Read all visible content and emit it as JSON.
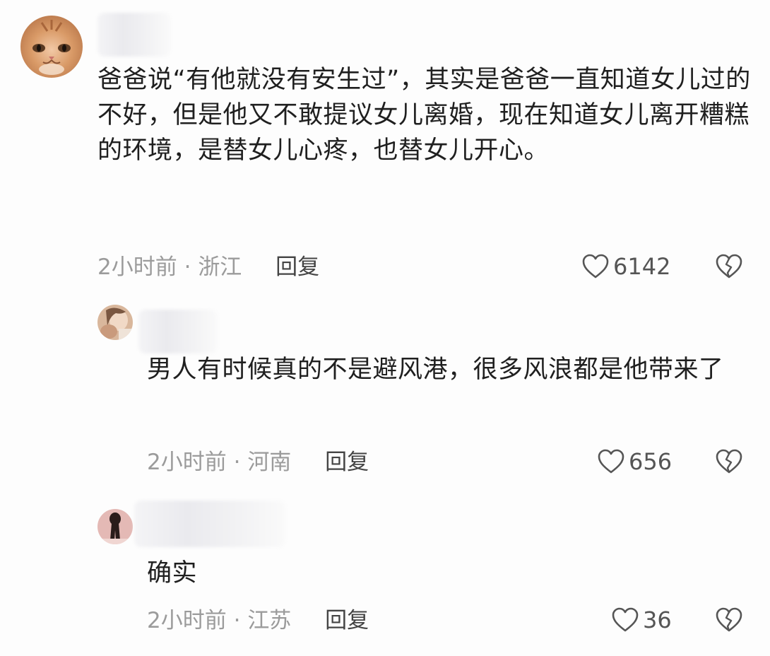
{
  "comments": [
    {
      "text": "爸爸说“有他就没有安生过”，其实是爸爸一直知道女儿过的不好，但是他又不敢提议女儿离婚，现在知道女儿离开糟糕的环境，是替女儿心疼，也替女儿开心。",
      "time": "2小时前",
      "location": "浙江",
      "reply_label": "回复",
      "likes": "6142"
    },
    {
      "text": "男人有时候真的不是避风港，很多风浪都是他带来了",
      "time": "2小时前",
      "location": "河南",
      "reply_label": "回复",
      "likes": "656"
    },
    {
      "text": "确实",
      "time": "2小时前",
      "location": "江苏",
      "reply_label": "回复",
      "likes": "36"
    }
  ],
  "meta_separator": "·",
  "colors": {
    "text": "#1f1f1f",
    "meta": "#9b9b9b",
    "icon": "#555555"
  }
}
